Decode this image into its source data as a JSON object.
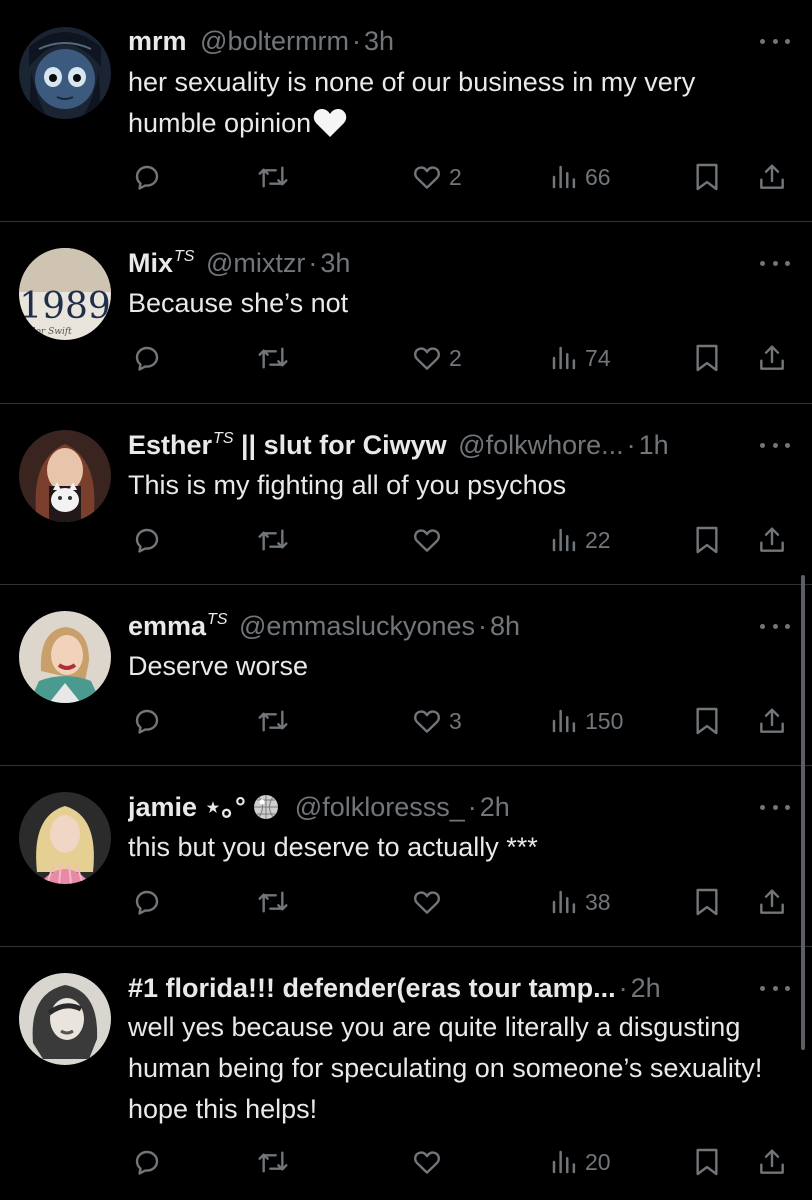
{
  "tweets": [
    {
      "name": "mrm",
      "badge": "",
      "handle": "@boltermrm",
      "time": "3h",
      "text": "her sexuality is none of our business in my very humble opinion",
      "emoji": "white-heart",
      "likes": "2",
      "views": "66"
    },
    {
      "name": "Mix",
      "badge": "TS",
      "handle": "@mixtzr",
      "time": "3h",
      "text": "Because she’s not",
      "likes": "2",
      "views": "74",
      "avatar_text": "1989",
      "avatar_caption": "aylor Swift"
    },
    {
      "name": "Esther",
      "badge": "TS",
      "name_suffix": " || slut for Ciwyw",
      "handle": "@folkwhore...",
      "time": "1h",
      "text": "This is my fighting all of you psychos",
      "likes": "",
      "views": "22"
    },
    {
      "name": "emma",
      "badge": "TS",
      "handle": "@emmasluckyones",
      "time": "8h",
      "text": "Deserve worse",
      "likes": "3",
      "views": "150"
    },
    {
      "name": "jamie ⋆｡°",
      "badge": "",
      "handle": "@folkloresss_",
      "time": "2h",
      "text": "this but you deserve to actually ***",
      "likes": "",
      "views": "38",
      "name_emoji": "disco-ball"
    },
    {
      "name": "#1 florida!!! defender(eras tour tamp...",
      "badge": "",
      "handle": "",
      "time": "2h",
      "text": "well yes because you are quite literally a disgusting human being for speculating on someone’s sexuality! hope this helps!",
      "likes": "",
      "views": "20"
    }
  ],
  "ui": {
    "separator": "·",
    "icons": {
      "reply": "reply-icon",
      "retweet": "retweet-icon",
      "like": "heart-icon",
      "views": "views-icon",
      "bookmark": "bookmark-icon",
      "share": "share-icon",
      "more": "more-icon"
    }
  }
}
